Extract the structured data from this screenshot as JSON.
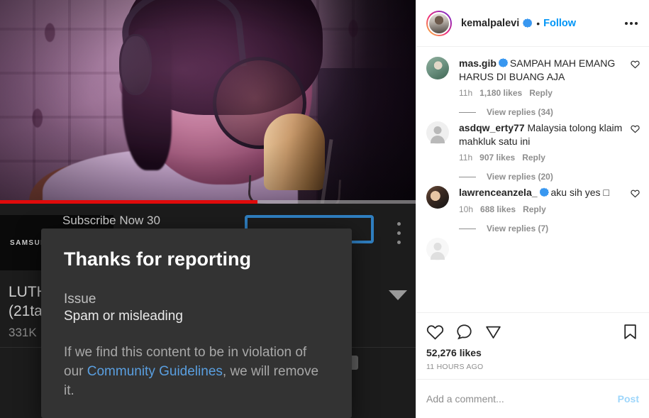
{
  "post": {
    "username": "kemalpalevi",
    "verified": true,
    "separator": "•",
    "follow_label": "Follow",
    "more_icon": "more-horizontal-icon"
  },
  "comments": [
    {
      "username": "mas.gib",
      "verified": true,
      "text": "SAMPAH MAH EMANG HARUS DI BUANG AJA",
      "time": "11h",
      "likes": "1,180 likes",
      "reply_label": "Reply",
      "view_replies": "View replies (34)",
      "avatar": "avatar-mas-gib"
    },
    {
      "username": "asdqw_erty77",
      "verified": false,
      "text": "Malaysia tolong klaim mahkluk satu ini",
      "time": "11h",
      "likes": "907 likes",
      "reply_label": "Reply",
      "view_replies": "View replies (20)",
      "avatar": "avatar-default"
    },
    {
      "username": "lawrenceanzela_",
      "verified": true,
      "text": "aku sih yes □",
      "time": "10h",
      "likes": "688 likes",
      "reply_label": "Reply",
      "view_replies": "View replies (7)",
      "avatar": "avatar-lawrenceanzela"
    }
  ],
  "actions": {
    "like_icon": "heart-icon",
    "comment_icon": "comment-bubble-icon",
    "share_icon": "share-paper-plane-icon",
    "save_icon": "bookmark-icon",
    "likes_count": "52,276 likes",
    "time_ago": "11 HOURS AGO"
  },
  "add_comment": {
    "placeholder": "Add a comment...",
    "value": "",
    "post_label": "Post"
  },
  "report_dialog": {
    "title": "Thanks for reporting",
    "issue_label": "Issue",
    "issue_value": "Spam or misleading",
    "body_before": "If we find this content to be in violation of our ",
    "link_text": "Community Guidelines",
    "body_after": ", we will remove it."
  },
  "video": {
    "brand_watermark": "SAMSUNG",
    "title_top_partial": "Subscribe Now 30",
    "title_line_1": "LUTH",
    "title_line_2": "(21ta",
    "views": "331K",
    "progress_percent": 62,
    "progress_color": "#e00b0b",
    "kebab_icon": "more-vertical-icon",
    "expand_icon": "chevron-down-icon",
    "cta_color": "#2f7fc1"
  },
  "colors": {
    "ig_link_blue": "#0095f6",
    "ig_text": "#262626",
    "ig_muted": "#8e8e8e",
    "dialog_bg": "#333333",
    "dialog_link": "#5a9fe0"
  }
}
